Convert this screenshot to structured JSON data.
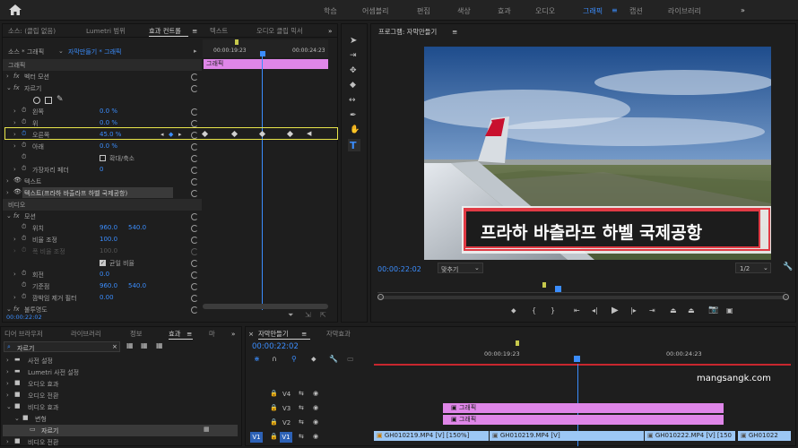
{
  "workspaces": [
    "학습",
    "어셈블리",
    "편집",
    "색상",
    "효과",
    "오디오",
    "그래픽",
    "캡션",
    "라이브러리"
  ],
  "active_workspace": "그래픽",
  "workspace_more": "»",
  "top_left": {
    "tabs": [
      "소스: (클립 없음)",
      "Lumetri 범위",
      "효과 컨트롤",
      "텍스트",
      "오디오 클립 믹서"
    ],
    "more": "»",
    "source_line": "소스 * 그래픽",
    "sequence_clip": "자막만들기 * 그래픽",
    "time_start": "00:00:19:23",
    "time_end": "00:00:24:23",
    "clip_label": "그래픽",
    "rows": [
      {
        "label": "그래픽",
        "indent": 0
      },
      {
        "label": "벡터 모션",
        "indent": 1,
        "fx": true
      },
      {
        "label": "자르기",
        "indent": 1,
        "fx": true
      },
      {
        "label": "왼쪽",
        "indent": 2,
        "value": "0.0 %"
      },
      {
        "label": "위",
        "indent": 2,
        "value": "0.0 %"
      },
      {
        "label": "오른쪽",
        "indent": 2,
        "value": "45.0 %"
      },
      {
        "label": "아래",
        "indent": 2,
        "value": "0.0 %"
      },
      {
        "label": "확대/축소",
        "indent": 3
      },
      {
        "label": "가장자리 페더",
        "indent": 2,
        "value": "0"
      },
      {
        "label": "텍스트",
        "indent": 1
      },
      {
        "label": "텍스트(프라하 바츨라프 하벨 국제공항)",
        "indent": 1
      },
      {
        "label": "비디오",
        "indent": 0
      },
      {
        "label": "모션",
        "indent": 1,
        "fx": true
      },
      {
        "label": "위치",
        "indent": 2,
        "value": "960.0",
        "value2": "540.0"
      },
      {
        "label": "비율 조정",
        "indent": 2,
        "value": "100.0"
      },
      {
        "label": "폭 비율 조정",
        "indent": 2,
        "value": "100.0",
        "dim": true
      },
      {
        "label": "균일 비율",
        "indent": 3
      },
      {
        "label": "회전",
        "indent": 2,
        "value": "0.0"
      },
      {
        "label": "기준점",
        "indent": 2,
        "value": "960.0",
        "value2": "540.0"
      },
      {
        "label": "깜박임 제거 필터",
        "indent": 2,
        "value": "0.00"
      },
      {
        "label": "불투명도",
        "indent": 1,
        "fx": true
      }
    ],
    "bottom_time": "00:00:22:02"
  },
  "program": {
    "title": "프로그램: 자막만들기",
    "menu": "≡",
    "caption": "프라하 바츨라프 하벨 국제공항",
    "timecode": "00:00:22:02",
    "fit": "맞추기",
    "resolution": "1/2"
  },
  "bottom_left": {
    "tabs": [
      "디어 브라우저",
      "라이브러리",
      "정보",
      "효과",
      "마"
    ],
    "more": "»",
    "search": "자르기",
    "tree": [
      {
        "label": "사전 설정",
        "indent": 0
      },
      {
        "label": "Lumetri 사전 설정",
        "indent": 0
      },
      {
        "label": "오디오 효과",
        "indent": 0
      },
      {
        "label": "오디오 전환",
        "indent": 0
      },
      {
        "label": "비디오 효과",
        "indent": 0,
        "open": true
      },
      {
        "label": "변형",
        "indent": 1,
        "open": true
      },
      {
        "label": "자르기",
        "indent": 2,
        "selected": true
      },
      {
        "label": "비디오 전환",
        "indent": 0
      }
    ]
  },
  "timeline": {
    "tabs": [
      "자막만들기",
      "자막효과"
    ],
    "timecode": "00:00:22:02",
    "ruler": [
      "00:00:19:23",
      "00:00:24:23"
    ],
    "watermark": "mangsangk.com",
    "tracks": [
      "V4",
      "V3",
      "V2",
      "V1"
    ],
    "gfx_clips": [
      "그래픽",
      "그래픽"
    ],
    "video_clips": [
      "GH010219.MP4 [V] [150%]",
      "GH010219.MP4 [V]",
      "GH010222.MP4 [V] [150",
      "GH01022"
    ]
  }
}
